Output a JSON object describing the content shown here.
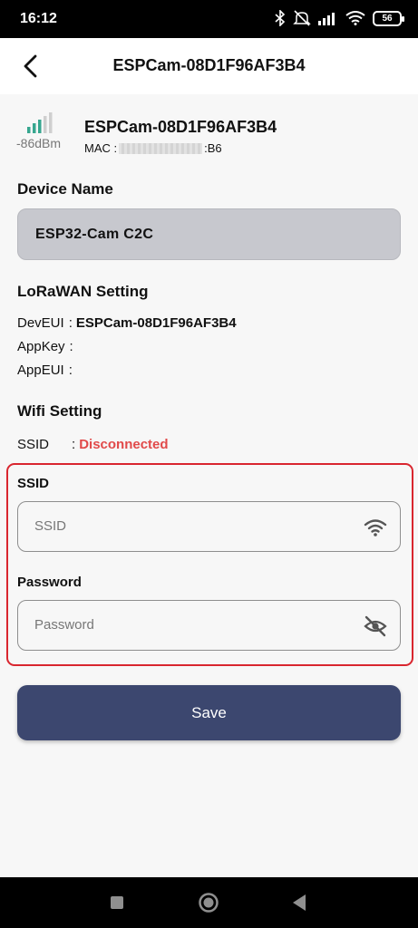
{
  "status_bar": {
    "time": "16:12",
    "battery": "56",
    "icons": [
      "bluetooth-icon",
      "mute-icon",
      "cellular-signal-icon",
      "wifi-icon",
      "battery-icon"
    ]
  },
  "app_bar": {
    "title": "ESPCam-08D1F96AF3B4",
    "back_icon": "back-arrow-icon"
  },
  "device": {
    "rssi": "-86dBm",
    "name": "ESPCam-08D1F96AF3B4",
    "mac_label": "MAC :",
    "mac_suffix": ":B6"
  },
  "device_name_section": {
    "title": "Device Name",
    "value": "ESP32-Cam C2C"
  },
  "lorawan_section": {
    "title": "LoRaWAN Setting",
    "rows": [
      {
        "label": "DevEUI",
        "sep": ":",
        "value": "ESPCam-08D1F96AF3B4"
      },
      {
        "label": "AppKey",
        "sep": ":",
        "value": ""
      },
      {
        "label": "AppEUI",
        "sep": ":",
        "value": ""
      }
    ]
  },
  "wifi_section": {
    "title": "Wifi Setting",
    "ssid_label": "SSID",
    "ssid_sep": ":",
    "ssid_status": "Disconnected",
    "status_color": "#e14a4a"
  },
  "wifi_form": {
    "ssid_label": "SSID",
    "ssid_placeholder": "SSID",
    "password_label": "Password",
    "password_placeholder": "Password",
    "highlight_color": "#d9262f"
  },
  "save_button": {
    "label": "Save",
    "color": "#3c476f"
  },
  "nav_bar": {
    "buttons": [
      "recents-square-icon",
      "home-circle-icon",
      "back-triangle-icon"
    ]
  }
}
